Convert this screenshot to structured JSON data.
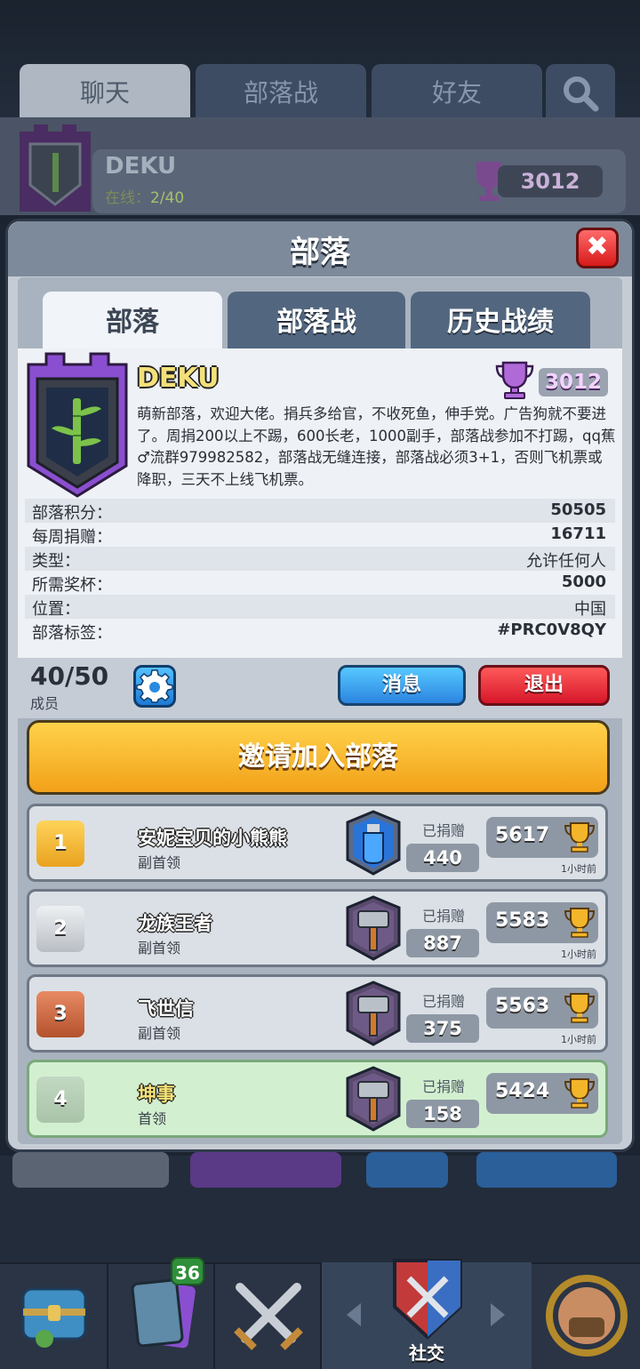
{
  "background": {
    "tabs": [
      "聊天",
      "部落战",
      "好友"
    ],
    "clan_name": "DEKU",
    "online_label": "在线：",
    "online_value": "2/40",
    "trophies": "3012"
  },
  "modal": {
    "title": "部落",
    "close_label": "✖",
    "tabs": [
      "部落",
      "部落战",
      "历史战绩"
    ],
    "clan": {
      "name": "DEKU",
      "trophies": "3012",
      "description": "萌新部落，欢迎大佬。捐兵多给官，不收死鱼，伸手党。广告狗就不要进了。周捐200以上不踢，600长老，1000副手，部落战参加不打踢，qq蕉♂流群979982582，部落战无缝连接，部落战必须3+1，否则飞机票或降职，三天不上线飞机票。"
    },
    "stats": [
      {
        "label": "部落积分：",
        "value": "50505"
      },
      {
        "label": "每周捐赠：",
        "value": "16711"
      },
      {
        "label": "类型：",
        "value": "允许任何人"
      },
      {
        "label": "所需奖杯：",
        "value": "5000"
      },
      {
        "label": "位置：",
        "value": "中国"
      },
      {
        "label": "部落标签：",
        "value": "#PRC0V8QY"
      }
    ],
    "members_count": "40/50",
    "members_label": "成员",
    "message_button": "消息",
    "exit_button": "退出",
    "invite_button": "邀请加入部落",
    "donated_label": "已捐赠",
    "members": [
      {
        "rank": "1",
        "name": "安妮宝贝的小熊熊",
        "role": "副首领",
        "donated": "440",
        "trophies": "5617",
        "last_seen": "1小时前",
        "card": "potion"
      },
      {
        "rank": "2",
        "name": "龙族王者",
        "role": "副首领",
        "donated": "887",
        "trophies": "5583",
        "last_seen": "1小时前",
        "card": "hammer"
      },
      {
        "rank": "3",
        "name": "飞世信",
        "role": "副首领",
        "donated": "375",
        "trophies": "5563",
        "last_seen": "1小时前",
        "card": "hammer"
      },
      {
        "rank": "4",
        "name": "坤事",
        "role": "首领",
        "donated": "158",
        "trophies": "5424",
        "last_seen": "",
        "card": "hammer"
      }
    ]
  },
  "nav": {
    "cards_badge": "36",
    "social_label": "社交"
  },
  "colors": {
    "accent_gold": "#f2a119",
    "blue_button": "#2b85e0",
    "red_button": "#d6162a",
    "clan_purple": "#8a4fd0"
  }
}
